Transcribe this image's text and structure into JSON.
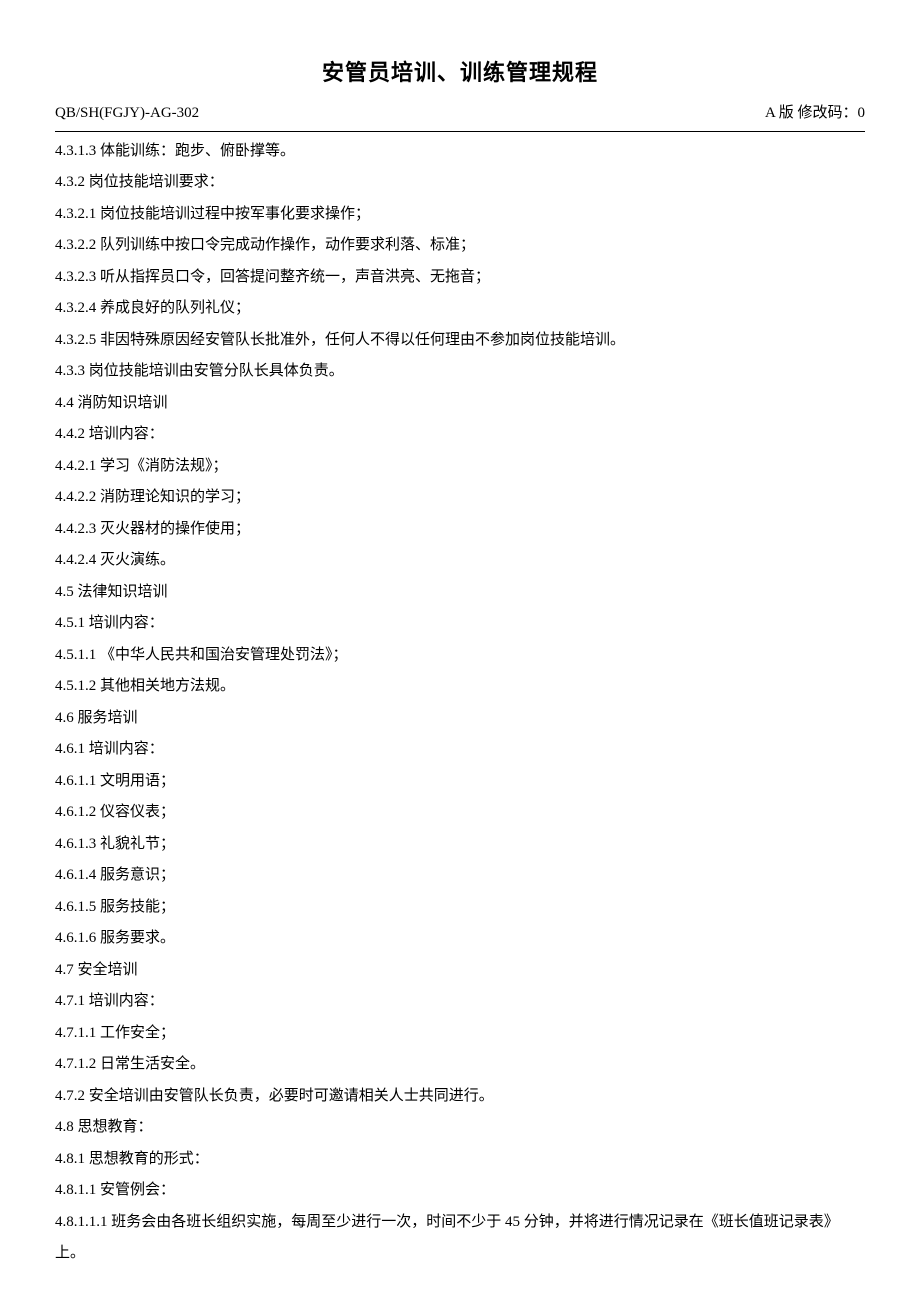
{
  "title": "安管员培训、训练管理规程",
  "header": {
    "docCode": "QB/SH(FGJY)-AG-302",
    "version": "A 版   修改码：0"
  },
  "lines": [
    "4.3.1.3   体能训练：跑步、俯卧撑等。",
    "4.3.2   岗位技能培训要求：",
    "4.3.2.1   岗位技能培训过程中按军事化要求操作；",
    "4.3.2.2   队列训练中按口令完成动作操作，动作要求利落、标准；",
    "4.3.2.3   听从指挥员口令，回答提问整齐统一，声音洪亮、无拖音；",
    "4.3.2.4   养成良好的队列礼仪；",
    "4.3.2.5   非因特殊原因经安管队长批准外，任何人不得以任何理由不参加岗位技能培训。",
    "4.3.3   岗位技能培训由安管分队长具体负责。",
    "4.4   消防知识培训",
    " 4.4.2   培训内容：",
    "4.4.2.1   学习《消防法规》；",
    "4.4.2.2   消防理论知识的学习；",
    "4.4.2.3   灭火器材的操作使用；",
    "4.4.2.4   灭火演练。",
    "4.5   法律知识培训",
    "4.5.1   培训内容：",
    "4.5.1.1   《中华人民共和国治安管理处罚法》；",
    "4.5.1.2   其他相关地方法规。",
    "4.6   服务培训",
    "4.6.1   培训内容：",
    "4.6.1.1   文明用语；",
    "4.6.1.2   仪容仪表；",
    "4.6.1.3   礼貌礼节；",
    "4.6.1.4   服务意识；",
    "4.6.1.5   服务技能；",
    "4.6.1.6   服务要求。",
    "4.7   安全培训",
    "4.7.1   培训内容：",
    "4.7.1.1   工作安全；",
    "4.7.1.2   日常生活安全。",
    "4.7.2   安全培训由安管队长负责，必要时可邀请相关人士共同进行。",
    "4.8   思想教育：",
    "4.8.1   思想教育的形式：",
    "4.8.1.1   安管例会：",
    "4.8.1.1.1   班务会由各班长组织实施，每周至少进行一次，时间不少于 45 分钟，并将进行情况记录在《班长值班记录表》上。"
  ]
}
